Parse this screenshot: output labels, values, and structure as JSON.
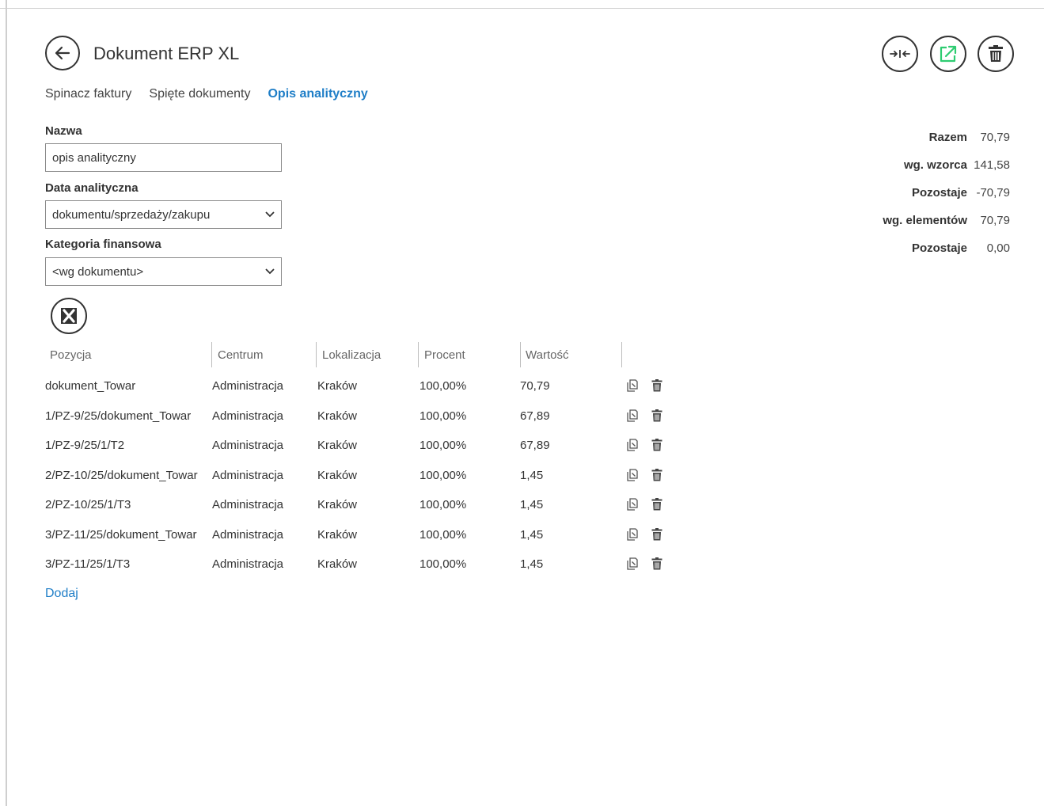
{
  "header": {
    "title": "Dokument ERP XL",
    "icons": {
      "back": "arrow-left-icon",
      "split": "split-icon",
      "open": "external-link-icon",
      "delete": "trash-icon"
    },
    "open_icon_color": "#2ecc71"
  },
  "tabs": [
    {
      "label": "Spinacz faktury",
      "active": false
    },
    {
      "label": "Spięte dokumenty",
      "active": false
    },
    {
      "label": "Opis analityczny",
      "active": true
    }
  ],
  "form": {
    "nazwa_label": "Nazwa",
    "nazwa_value": "opis analityczny",
    "data_label": "Data analityczna",
    "data_value": "dokumentu/sprzedaży/zakupu",
    "kategoria_label": "Kategoria finansowa",
    "kategoria_value": "<wg dokumentu>"
  },
  "summary": [
    {
      "label": "Razem",
      "value": "70,79"
    },
    {
      "label": "wg. wzorca",
      "value": "141,58"
    },
    {
      "label": "Pozostaje",
      "value": "-70,79"
    },
    {
      "label": "wg. elementów",
      "value": "70,79"
    },
    {
      "label": "Pozostaje",
      "value": "0,00"
    }
  ],
  "table": {
    "columns": [
      "Pozycja",
      "Centrum",
      "Lokalizacja",
      "Procent",
      "Wartość"
    ],
    "rows": [
      {
        "pozycja": "dokument_Towar",
        "centrum": "Administracja",
        "lokalizacja": "Kraków",
        "procent": "100,00%",
        "wartosc": "70,79"
      },
      {
        "pozycja": "1/PZ-9/25/dokument_Towar",
        "centrum": "Administracja",
        "lokalizacja": "Kraków",
        "procent": "100,00%",
        "wartosc": "67,89"
      },
      {
        "pozycja": "1/PZ-9/25/1/T2",
        "centrum": "Administracja",
        "lokalizacja": "Kraków",
        "procent": "100,00%",
        "wartosc": "67,89"
      },
      {
        "pozycja": "2/PZ-10/25/dokument_Towar",
        "centrum": "Administracja",
        "lokalizacja": "Kraków",
        "procent": "100,00%",
        "wartosc": "1,45"
      },
      {
        "pozycja": "2/PZ-10/25/1/T3",
        "centrum": "Administracja",
        "lokalizacja": "Kraków",
        "procent": "100,00%",
        "wartosc": "1,45"
      },
      {
        "pozycja": "3/PZ-11/25/dokument_Towar",
        "centrum": "Administracja",
        "lokalizacja": "Kraków",
        "procent": "100,00%",
        "wartosc": "1,45"
      },
      {
        "pozycja": "3/PZ-11/25/1/T3",
        "centrum": "Administracja",
        "lokalizacja": "Kraków",
        "procent": "100,00%",
        "wartosc": "1,45"
      }
    ]
  },
  "add_label": "Dodaj"
}
